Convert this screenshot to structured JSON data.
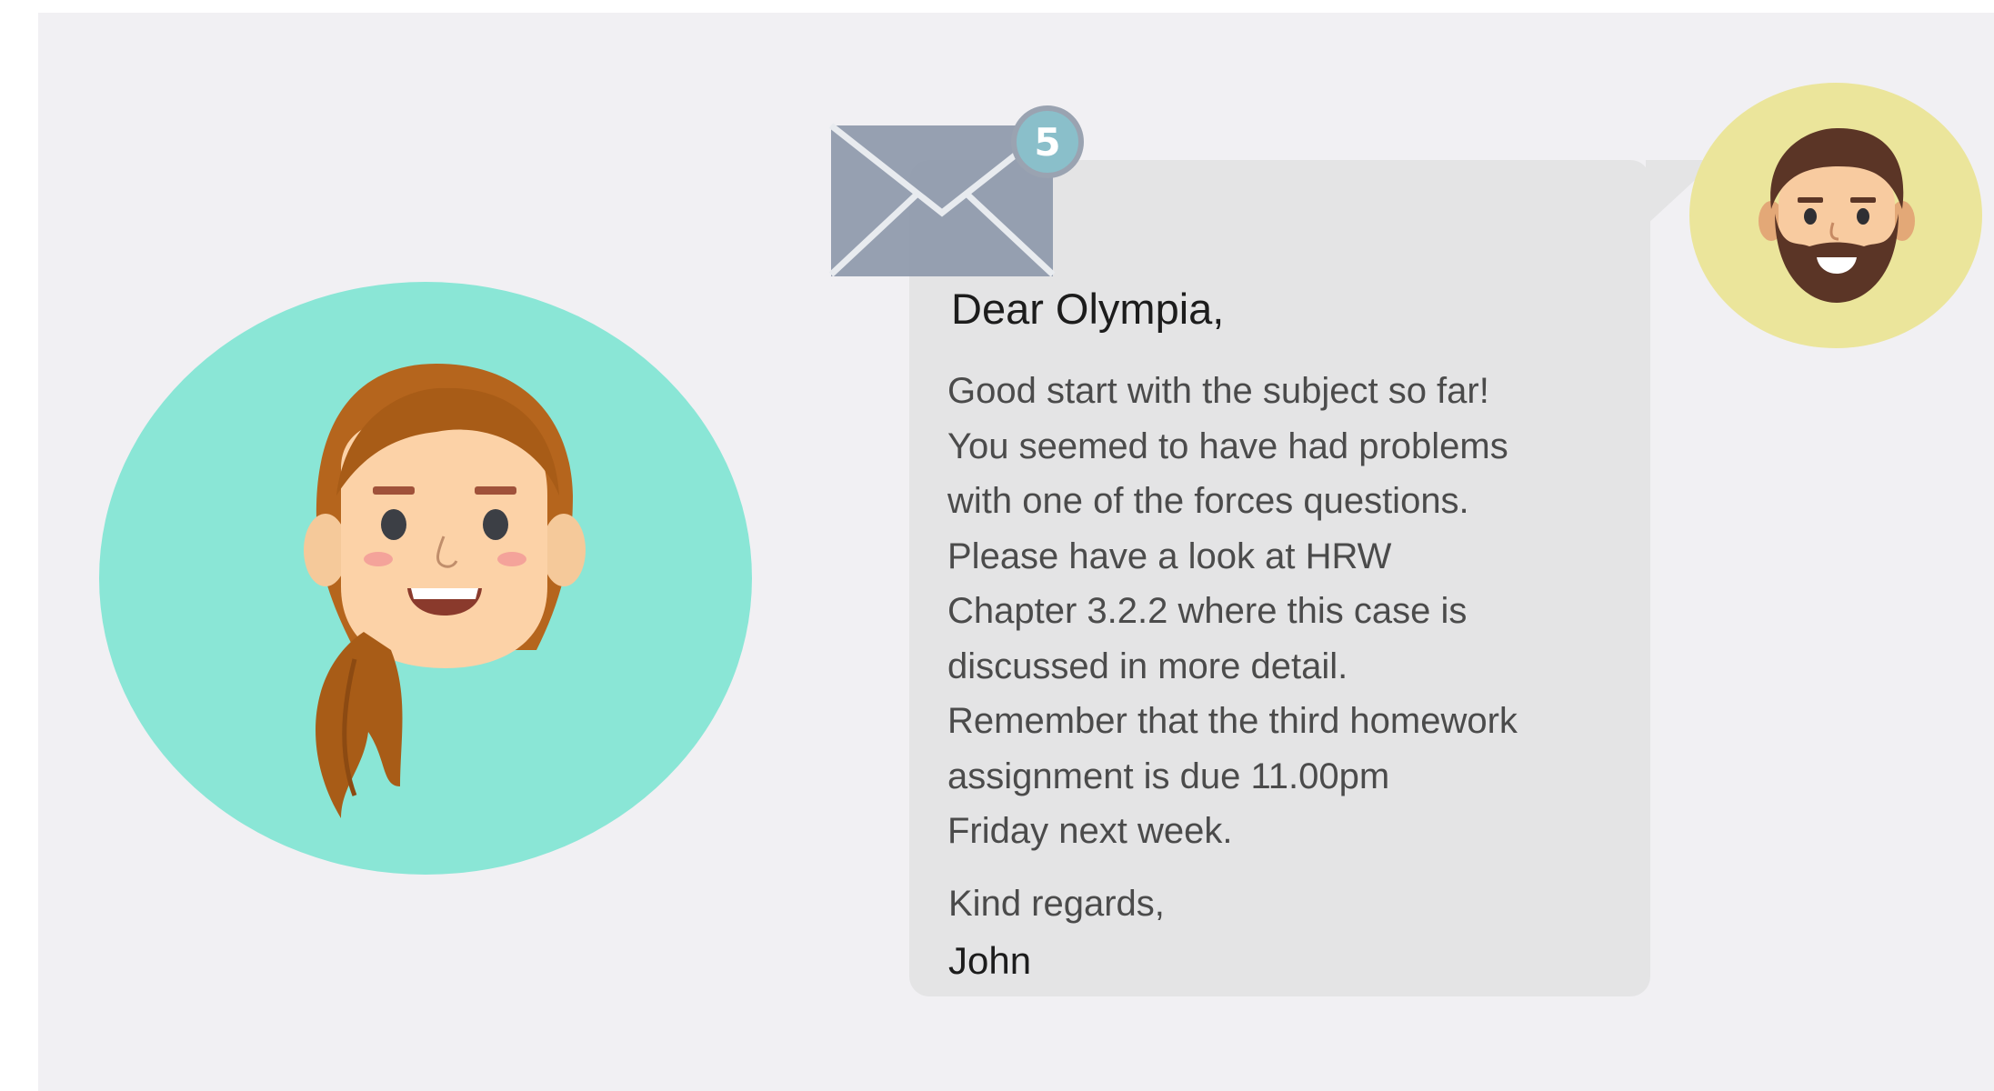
{
  "email": {
    "unread_count": "5",
    "greeting": "Dear Olympia,",
    "body_lines": [
      "Good start with the subject so far!",
      "You seemed to have had problems",
      "with one of the forces questions.",
      "Please have a look at HRW",
      "Chapter 3.2.2 where this case is",
      "discussed in more detail.",
      "Remember that the third homework",
      "assignment is due 11.00pm",
      "Friday next week."
    ],
    "closing": "Kind regards,",
    "signature": "John"
  },
  "icons": {
    "envelope": "envelope-icon",
    "recipient_avatar": "woman-avatar",
    "sender_avatar": "bearded-man-avatar"
  },
  "colors": {
    "background": "#f1f0f3",
    "recipient_circle": "#8ae6d6",
    "sender_circle": "#ebe59b",
    "bubble": "#e4e4e5",
    "envelope": "#8e99ab",
    "badge": "#8abfca"
  }
}
